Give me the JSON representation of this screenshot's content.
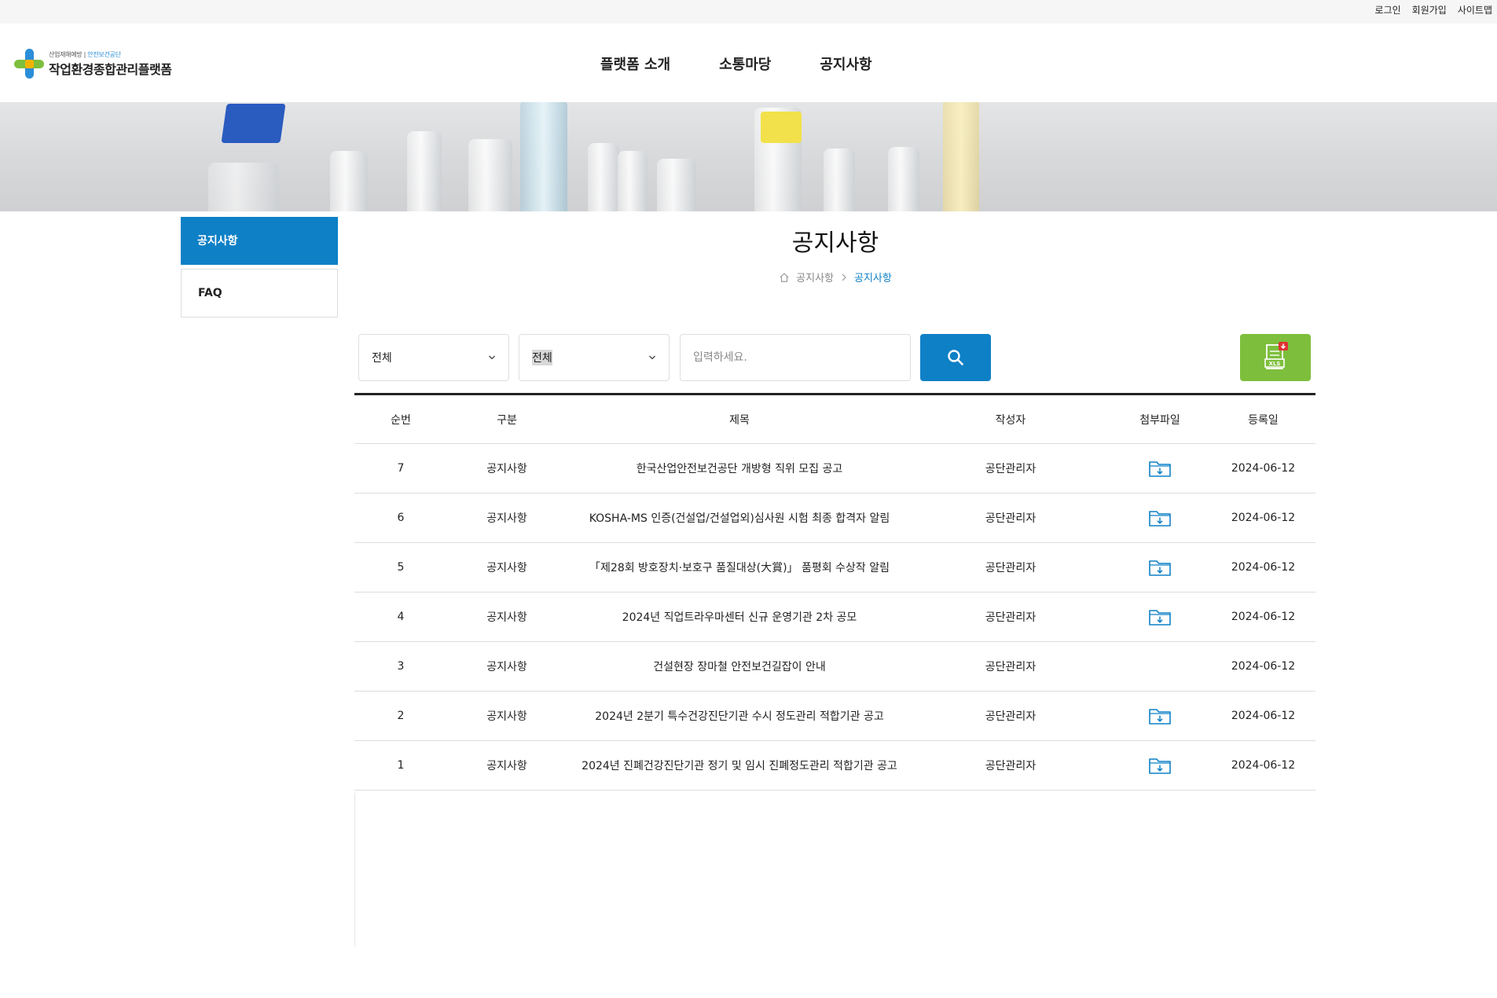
{
  "util_links": [
    "로그인",
    "회원가입",
    "사이트맵"
  ],
  "logo": {
    "sub_left": "산업재해예방",
    "sub_right": "안전보건공단",
    "main": "작업환경종합관리플랫폼"
  },
  "gnb": [
    "플랫폼 소개",
    "소통마당",
    "공지사항"
  ],
  "sidebar": {
    "items": [
      {
        "label": "공지사항",
        "active": true
      },
      {
        "label": "FAQ",
        "active": false
      }
    ]
  },
  "page": {
    "title": "공지사항",
    "breadcrumb": [
      "공지사항",
      "공지사항"
    ]
  },
  "filters": {
    "select1": "전체",
    "select2": "전체",
    "search_placeholder": "입력하세요.",
    "search_value": ""
  },
  "excel_label": "XLS",
  "table": {
    "headers": [
      "순번",
      "구분",
      "제목",
      "작성자",
      "첨부파일",
      "등록일"
    ],
    "rows": [
      {
        "no": "7",
        "category": "공지사항",
        "title": "한국산업안전보건공단 개방형 직위 모집 공고",
        "author": "공단관리자",
        "attachment": true,
        "date": "2024-06-12"
      },
      {
        "no": "6",
        "category": "공지사항",
        "title": "KOSHA-MS 인증(건설업/건설업외)심사원 시험 최종 합격자 알림",
        "author": "공단관리자",
        "attachment": true,
        "date": "2024-06-12"
      },
      {
        "no": "5",
        "category": "공지사항",
        "title": "「제28회 방호장치·보호구 품질대상(大賞)」 품평회 수상작 알림",
        "author": "공단관리자",
        "attachment": true,
        "date": "2024-06-12"
      },
      {
        "no": "4",
        "category": "공지사항",
        "title": "2024년 직업트라우마센터 신규 운영기관 2차 공모",
        "author": "공단관리자",
        "attachment": true,
        "date": "2024-06-12"
      },
      {
        "no": "3",
        "category": "공지사항",
        "title": "건설현장 장마철 안전보건길잡이 안내",
        "author": "공단관리자",
        "attachment": false,
        "date": "2024-06-12"
      },
      {
        "no": "2",
        "category": "공지사항",
        "title": "2024년 2분기 특수건강진단기관 수시 정도관리 적합기관 공고",
        "author": "공단관리자",
        "attachment": true,
        "date": "2024-06-12"
      },
      {
        "no": "1",
        "category": "공지사항",
        "title": "2024년 진폐건강진단기관 정기 및 임시 진폐정도관리 적합기관 공고",
        "author": "공단관리자",
        "attachment": true,
        "date": "2024-06-12"
      }
    ]
  },
  "colors": {
    "primary": "#0e80c6",
    "excel": "#7dbf3c",
    "excel_badge": "#e03232"
  }
}
